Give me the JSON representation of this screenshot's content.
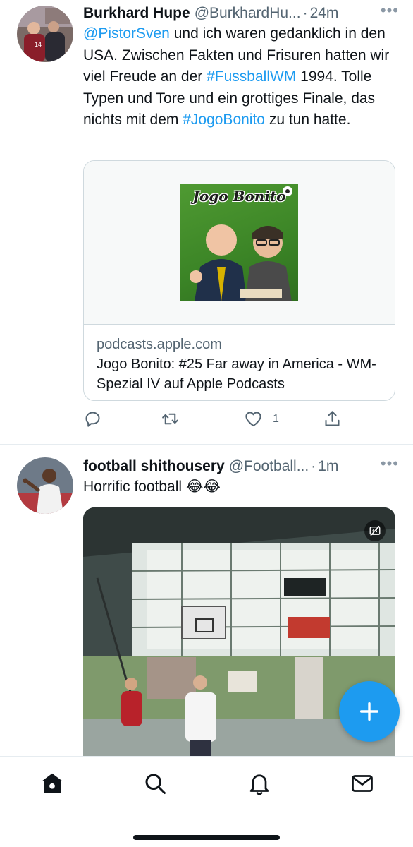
{
  "tweets": [
    {
      "name": "Burkhard Hupe",
      "handle": "@BurkhardHu...",
      "separator": "·",
      "time": "24m",
      "more": "•••",
      "text": {
        "mention": "@PistorSven",
        "t1": " und ich waren gedanklich in den USA. Zwischen Fakten und Frisuren hatten wir viel Freude an der ",
        "hashtag1": "#FussballWM",
        "t2": " 1994. Tolle Typen und Tore und ein grottiges Finale, das nichts mit dem ",
        "hashtag2": "#JogoBonito",
        "t3": " zu tun hatte."
      },
      "card": {
        "art_title": "Jogo Bonito",
        "domain": "podcasts.apple.com",
        "title": "Jogo Bonito: #25 Far away in America - WM-Spezial IV auf Apple Podcasts"
      },
      "actions": {
        "reply_icon": "reply-icon",
        "retweet_icon": "retweet-icon",
        "like_icon": "heart-icon",
        "like_count": "1",
        "share_icon": "share-icon"
      }
    },
    {
      "name": "football shithousery",
      "handle": "@Football...",
      "separator": "·",
      "time": "1m",
      "more": "•••",
      "text": "Horrific football 😂😂",
      "video": {
        "caption_icon": "closed-captions-off-icon"
      }
    }
  ],
  "fab": {
    "icon": "plus-icon",
    "color": "#1d9bf0"
  },
  "nav": [
    "home-icon",
    "search-icon",
    "bell-icon",
    "mail-icon"
  ],
  "colors": {
    "accent": "#1d9bf0",
    "secondary_text": "#536471",
    "border": "#cfd9de"
  }
}
